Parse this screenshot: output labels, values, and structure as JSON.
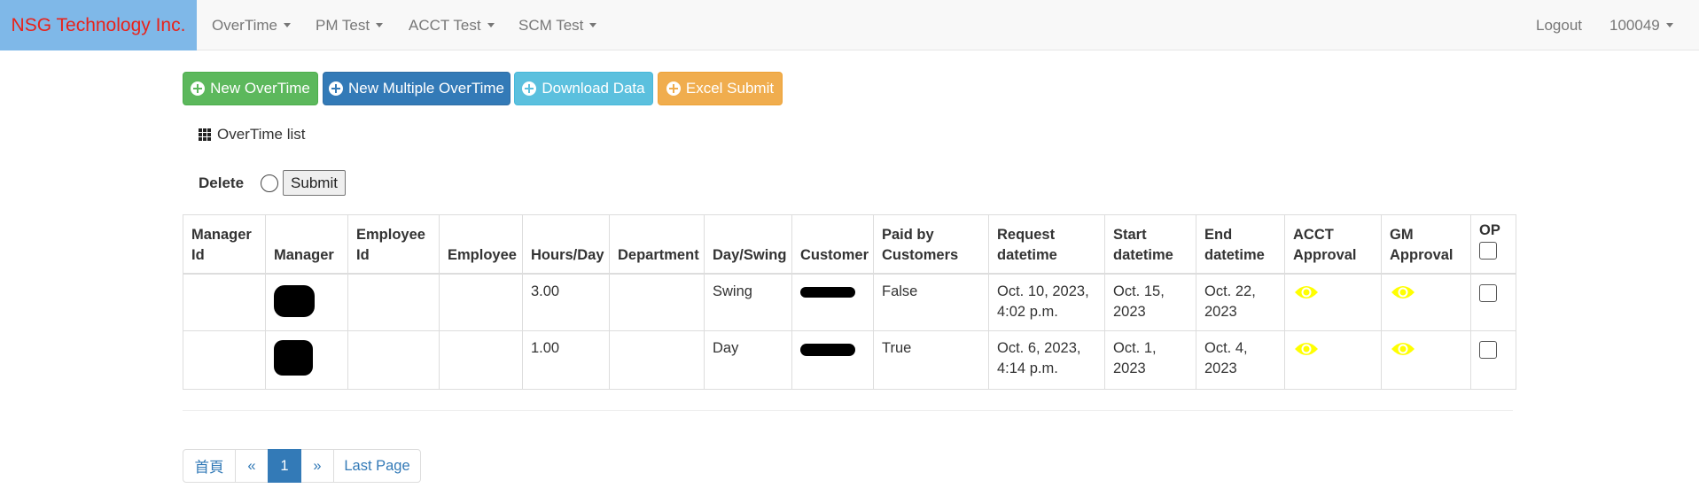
{
  "navbar": {
    "brand": "NSG Technology Inc.",
    "brand_bg": "#7fb8e8",
    "brand_color": "#e8231b",
    "menus": [
      {
        "label": "OverTime"
      },
      {
        "label": "PM Test"
      },
      {
        "label": "ACCT Test"
      },
      {
        "label": "SCM Test"
      }
    ],
    "logout": "Logout",
    "user": "100049"
  },
  "actions": {
    "new_overtime": "New OverTime",
    "new_multiple": "New Multiple OverTime",
    "download": "Download Data",
    "excel_submit": "Excel Submit"
  },
  "list": {
    "title": "OverTime list",
    "delete_label": "Delete",
    "submit_label": "Submit"
  },
  "table": {
    "headers": {
      "manager_id": "Manager Id",
      "manager": "Manager",
      "employee_id": "Employee Id",
      "employee": "Employee",
      "hours": "Hours/Day",
      "department": "Department",
      "day_swing": "Day/Swing",
      "customer": "Customer",
      "paid": "Paid by Customers",
      "request": "Request datetime",
      "start": "Start datetime",
      "end": "End datetime",
      "acct": "ACCT Approval",
      "gm": "GM Approval",
      "op": "OP"
    },
    "rows": [
      {
        "hours": "3.00",
        "day_swing": "Swing",
        "paid": "False",
        "request": "Oct. 10, 2023, 4:02 p.m.",
        "start": "Oct. 15, 2023",
        "end": "Oct. 22, 2023",
        "acct_icon": "eye-icon",
        "gm_icon": "eye-icon"
      },
      {
        "hours": "1.00",
        "day_swing": "Day",
        "paid": "True",
        "request": "Oct. 6, 2023, 4:14 p.m.",
        "start": "Oct. 1, 2023",
        "end": "Oct. 4, 2023",
        "acct_icon": "eye-icon",
        "gm_icon": "eye-icon"
      }
    ]
  },
  "pagination": {
    "first": "首頁",
    "prev": "«",
    "current": "1",
    "next": "»",
    "last": "Last Page"
  },
  "colors": {
    "eye": "#ffff00",
    "success": "#5cb85c",
    "primary": "#337ab7",
    "info": "#5bc0de",
    "warning": "#f0ad4e"
  }
}
